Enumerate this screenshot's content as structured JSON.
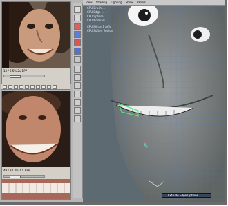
{
  "viewport_menu": {
    "items": [
      "View",
      "Shading",
      "Lighting",
      "Show",
      "Panels"
    ]
  },
  "hud_lines": [
    "CPU Brush ... ",
    "CPU Edge ...",
    "CPU Sphere ...",
    "CPU Normals ..."
  ],
  "hud_lines2": [
    "CPU Mirror 1 Affix",
    "CPU Soften Region"
  ],
  "ref_top": {
    "status": "13 / 2.5% 2x BPP"
  },
  "ref_bottom": {
    "status": "49 / 33.3% 1 X BPP"
  },
  "taskbar": {
    "label": "Extrude Edge Options"
  },
  "colors": {
    "viewport_bg": "#5e6a72",
    "mesh_wire": "#4a7bd6",
    "selection": "#58e27a"
  }
}
